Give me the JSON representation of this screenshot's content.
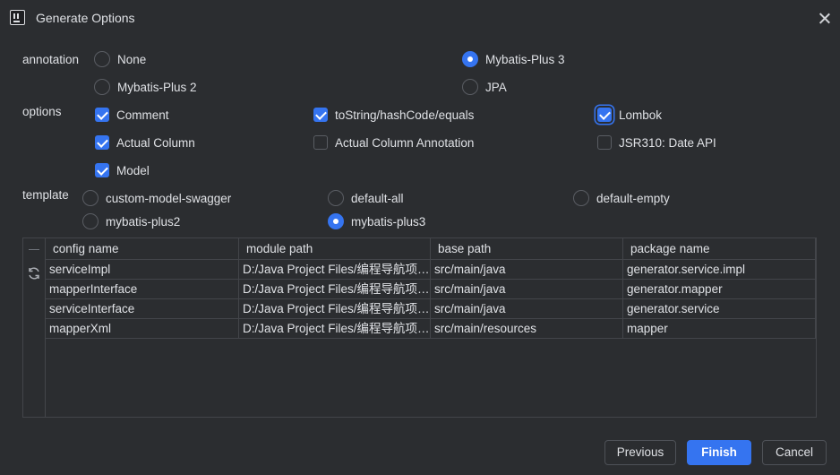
{
  "window": {
    "title": "Generate Options"
  },
  "annotation": {
    "label": "annotation",
    "options": [
      {
        "label": "None",
        "selected": false
      },
      {
        "label": "Mybatis-Plus 3",
        "selected": true
      },
      {
        "label": "Mybatis-Plus 2",
        "selected": false
      },
      {
        "label": "JPA",
        "selected": false
      }
    ]
  },
  "options": {
    "label": "options",
    "items": [
      {
        "label": "Comment",
        "checked": true
      },
      {
        "label": "toString/hashCode/equals",
        "checked": true
      },
      {
        "label": "Lombok",
        "checked": true
      },
      {
        "label": "Actual Column",
        "checked": true
      },
      {
        "label": "Actual Column Annotation",
        "checked": false
      },
      {
        "label": "JSR310: Date API",
        "checked": false
      },
      {
        "label": "Model",
        "checked": true
      }
    ]
  },
  "template": {
    "label": "template",
    "options": [
      {
        "label": "custom-model-swagger",
        "selected": false
      },
      {
        "label": "default-all",
        "selected": false
      },
      {
        "label": "default-empty",
        "selected": false
      },
      {
        "label": "mybatis-plus2",
        "selected": false
      },
      {
        "label": "mybatis-plus3",
        "selected": true
      }
    ]
  },
  "table": {
    "columns": [
      "config name",
      "module path",
      "base path",
      "package name"
    ],
    "rows": [
      [
        "serviceImpl",
        "D:/Java Project Files/编程导航项…",
        "src/main/java",
        "generator.service.impl"
      ],
      [
        "mapperInterface",
        "D:/Java Project Files/编程导航项…",
        "src/main/java",
        "generator.mapper"
      ],
      [
        "serviceInterface",
        "D:/Java Project Files/编程导航项…",
        "src/main/java",
        "generator.service"
      ],
      [
        "mapperXml",
        "D:/Java Project Files/编程导航项…",
        "src/main/resources",
        "mapper"
      ]
    ]
  },
  "buttons": {
    "previous": "Previous",
    "finish": "Finish",
    "cancel": "Cancel"
  },
  "colors": {
    "accent": "#3574f0",
    "background": "#2b2d30",
    "border": "#43454a"
  }
}
